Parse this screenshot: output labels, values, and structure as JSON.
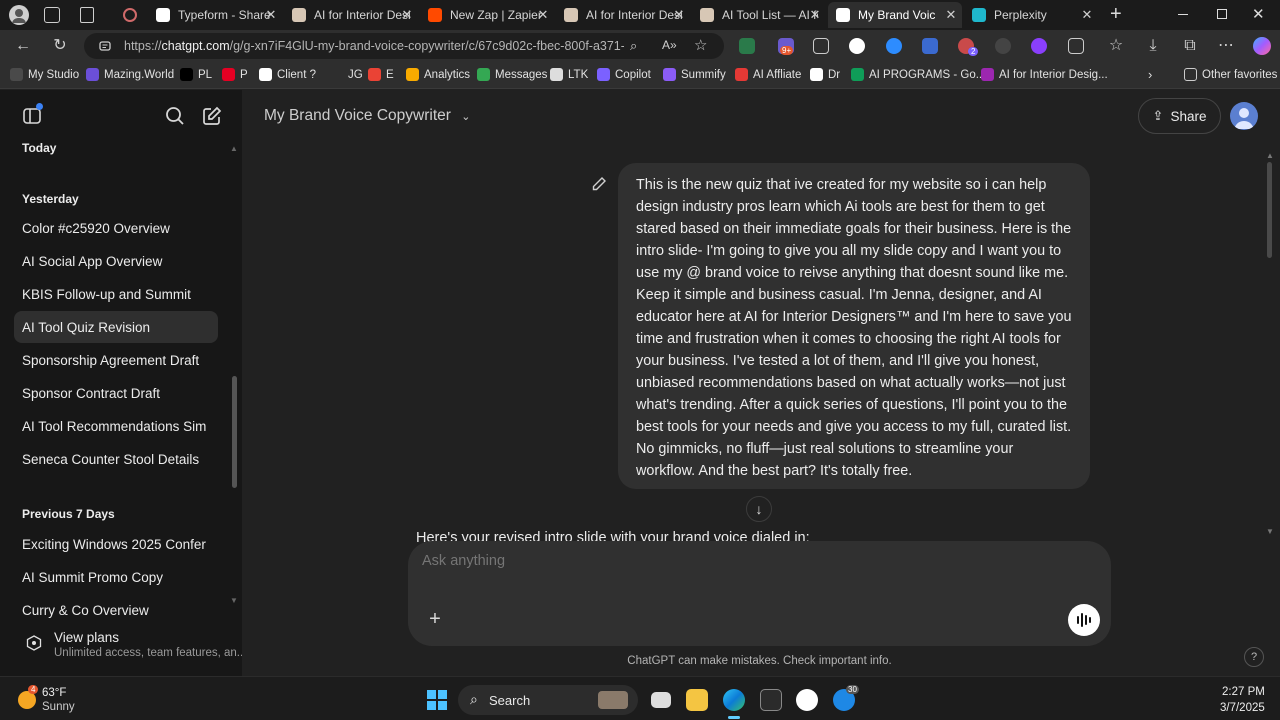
{
  "browser": {
    "tabs": [
      {
        "title": "Typeform - Share",
        "favicon": "typeform-icon",
        "color": "#ffffff",
        "active": false
      },
      {
        "title": "AI for Interior Desig",
        "favicon": "ai-interior-icon",
        "color": "#d7c7b5",
        "active": false
      },
      {
        "title": "New Zap | Zapier",
        "favicon": "zapier-icon",
        "color": "#ff4a00",
        "active": false
      },
      {
        "title": "AI for Interior Desig",
        "favicon": "ai-interior-icon",
        "color": "#d7c7b5",
        "active": false
      },
      {
        "title": "AI Tool List — AI fo",
        "favicon": "ai-interior-icon",
        "color": "#d7c7b5",
        "active": false
      },
      {
        "title": "My Brand Voic",
        "favicon": "chatgpt-icon",
        "color": "#ffffff",
        "active": true
      },
      {
        "title": "Perplexity",
        "favicon": "perplexity-icon",
        "color": "#1fb8cd",
        "active": false
      }
    ],
    "new_tab_label": "+",
    "url_prefix": "https://",
    "url_host": "chatgpt.com",
    "url_path": "/g/g-xn7iF4GlU-my-brand-voice-copywriter/c/67c9d02c-fbec-800f-a371-...",
    "ext_badge_count": "9+",
    "ext_badge_count2": "2"
  },
  "bookmarks": [
    {
      "label": "My Studio",
      "color": "#4a4a4a"
    },
    {
      "label": "Mazing.World",
      "color": "#6b4fd8"
    },
    {
      "label": "PL",
      "color": "#000000"
    },
    {
      "label": "P",
      "color": "#e60023"
    },
    {
      "label": "Client ?",
      "color": "#ffffff"
    },
    {
      "label": "JG",
      "color": "#2e2e2e"
    },
    {
      "label": "E",
      "color": "#ea4335"
    },
    {
      "label": "Analytics",
      "color": "#f9ab00"
    },
    {
      "label": "Messages",
      "color": "#34a853"
    },
    {
      "label": "LTK",
      "color": "#dddddd"
    },
    {
      "label": "Copilot",
      "color": "#7b61ff"
    },
    {
      "label": "Summify",
      "color": "#8b5cf6"
    },
    {
      "label": "AI Affliate",
      "color": "#e53935"
    },
    {
      "label": "Dr",
      "color": "#ffffff"
    },
    {
      "label": "AI PROGRAMS - Go...",
      "color": "#0f9d58"
    },
    {
      "label": "AI for Interior Desig...",
      "color": "#9c27b0"
    }
  ],
  "other_favorites": "Other favorites",
  "sidebar": {
    "today_label": "Today",
    "yesterday_label": "Yesterday",
    "yesterday_items": [
      "Color #c25920 Overview",
      "AI Social App Overview",
      "KBIS Follow-up and Summit",
      "AI Tool Quiz Revision",
      "Sponsorship Agreement Draft",
      "Sponsor Contract Draft",
      "AI Tool Recommendations Sim",
      "Seneca Counter Stool Details"
    ],
    "selected_index": 3,
    "prev7_label": "Previous 7 Days",
    "prev7_items": [
      "Exciting Windows 2025 Confer",
      "AI Summit Promo Copy",
      "Curry & Co Overview"
    ],
    "plans_title": "View plans",
    "plans_sub": "Unlimited access, team features, an..."
  },
  "main": {
    "model_title": "My Brand Voice Copywriter",
    "share_label": "Share",
    "user_message": "This is the new quiz that ive created for my website so i can help design industry pros learn which Ai tools are best for them to get stared based on their immediate goals for their business. Here is the intro slide- I'm going to give you all my slide copy and I want you to use my @ brand voice to reivse anything that doesnt sound like me. Keep it simple and business casual. I'm Jenna, designer, and AI educator here at AI for Interior Designers™ and I'm here to save you time and frustration when it comes to choosing the right AI tools for your business. I've tested a lot of them, and I'll give you honest, unbiased recommendations based on what actually works—not just what's trending. After a quick series of questions, I'll point you to the best tools for your needs and give you access to my full, curated list. No gimmicks, no fluff—just real solutions to streamline your workflow. And the best part? It's totally free.",
    "assistant_preview": "Here's your revised intro slide with your brand voice dialed in:",
    "composer_placeholder": "Ask anything",
    "disclaimer": "ChatGPT can make mistakes. Check important info.",
    "help_label": "?"
  },
  "taskbar": {
    "weather_temp": "63°F",
    "weather_cond": "Sunny",
    "weather_badge": "4",
    "search_label": "Search",
    "time": "2:27 PM",
    "date": "3/7/2025",
    "badge_count": "30"
  }
}
